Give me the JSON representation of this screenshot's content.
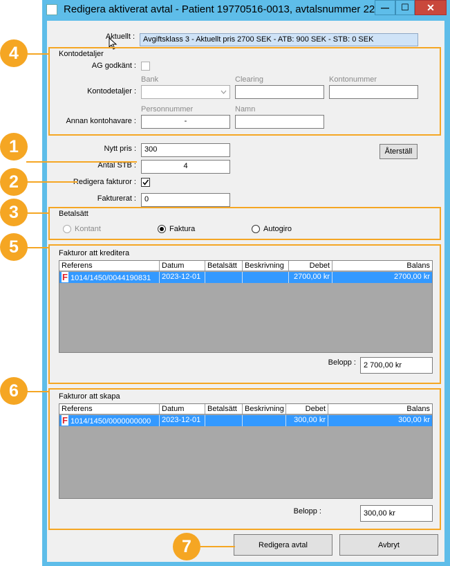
{
  "window": {
    "title": "Redigera aktiverat avtal - Patient 19770516-0013, avtalsnummer 22...",
    "minimize_glyph": "—",
    "maximize_glyph": "☐",
    "close_glyph": "✕"
  },
  "aktuellt": {
    "label": "Aktuellt :",
    "value": "Avgiftsklass 3 - Aktuellt pris 2700 SEK - ATB: 900 SEK - STB: 0 SEK"
  },
  "kontodetaljer": {
    "group_title": "Kontodetaljer",
    "ag_label": "AG godkänt :",
    "konto_label": "Kontodetaljer :",
    "bank_header": "Bank",
    "clearing_header": "Clearing",
    "kontonummer_header": "Kontonummer",
    "annan_label": "Annan kontohavare :",
    "personnummer_header": "Personnummer",
    "namn_header": "Namn",
    "personnummer_value": "-"
  },
  "pricing": {
    "nytt_pris_label": "Nytt pris :",
    "nytt_pris_value": "300",
    "antal_stb_label": "Antal STB :",
    "antal_stb_value": "4",
    "redigera_label": "Redigera fakturor :",
    "fakturerat_label": "Fakturerat :",
    "fakturerat_value": "0",
    "aterstall_label": "Återställ"
  },
  "betalsatt": {
    "group_title": "Betalsätt",
    "options": [
      "Kontant",
      "Faktura",
      "Autogiro"
    ],
    "selected": "Faktura"
  },
  "grid_headers": [
    "Referens",
    "Datum",
    "Betalsätt",
    "Beskrivning",
    "Debet",
    "Balans"
  ],
  "kreditera": {
    "group_title": "Fakturor att kreditera",
    "rows": [
      {
        "referens": "1014/1450/0044190831",
        "datum": "2023-12-01",
        "betalsatt": "",
        "beskrivning": "",
        "debet": "2700,00 kr",
        "balans": "2700,00 kr"
      }
    ],
    "belopp_label": "Belopp :",
    "belopp_value": "2 700,00 kr"
  },
  "skapa": {
    "group_title": "Fakturor att skapa",
    "rows": [
      {
        "referens": "1014/1450/0000000000",
        "datum": "2023-12-01",
        "betalsatt": "",
        "beskrivning": "",
        "debet": "300,00 kr",
        "balans": "300,00 kr"
      }
    ],
    "belopp_label": "Belopp :",
    "belopp_value": "300,00 kr"
  },
  "footer": {
    "redigera_button": "Redigera avtal",
    "avbryt_button": "Avbryt"
  },
  "badges": [
    "1",
    "2",
    "3",
    "4",
    "5",
    "6",
    "7"
  ],
  "row_icon_glyph": "F",
  "colors": {
    "titlebar": "#5ebde9",
    "highlight_orange": "#f5a623",
    "selection_blue": "#3399ff",
    "close_red": "#c9483c"
  }
}
